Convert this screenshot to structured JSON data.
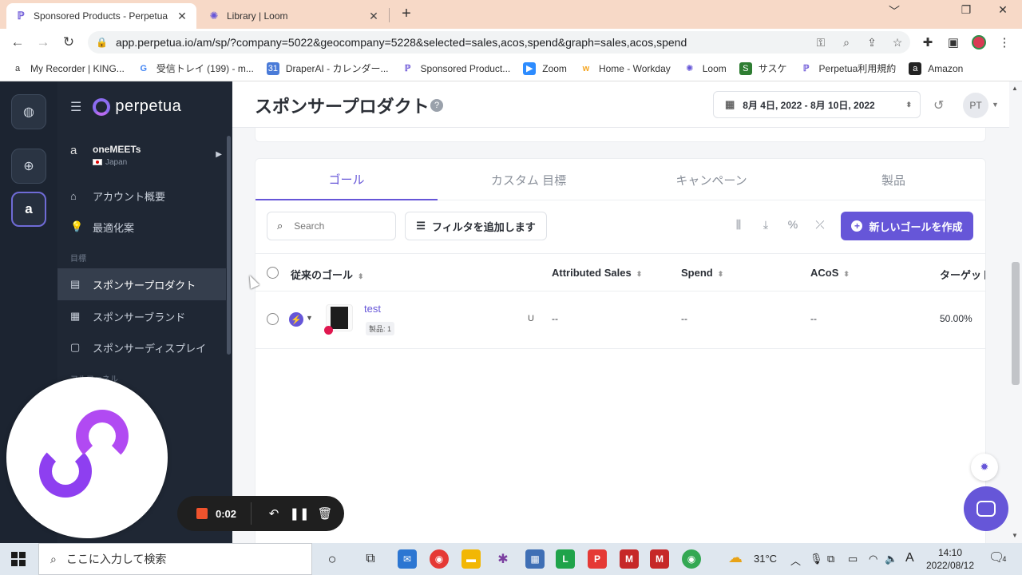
{
  "browser": {
    "tabs": [
      {
        "title": "Sponsored Products - Perpetua",
        "active": true,
        "icon": "perpetua-icon"
      },
      {
        "title": "Library | Loom",
        "active": false,
        "icon": "loom-icon"
      }
    ],
    "new_tab": "+",
    "window_controls": {
      "minimize": "﹀",
      "restore": "❐",
      "close": "✕"
    },
    "url": "app.perpetua.io/am/sp/?company=5022&geocompany=5228&selected=sales,acos,spend&graph=sales,acos,spend",
    "bookmarks": [
      {
        "label": "My Recorder | KING...",
        "icon": "amazon-icon"
      },
      {
        "label": "受信トレイ (199) - m...",
        "icon": "google-icon"
      },
      {
        "label": "DraperAI - カレンダー...",
        "icon": "calendar-icon"
      },
      {
        "label": "Sponsored Product...",
        "icon": "perpetua-icon"
      },
      {
        "label": "Zoom",
        "icon": "zoom-icon"
      },
      {
        "label": "Home - Workday",
        "icon": "workday-icon"
      },
      {
        "label": "Loom",
        "icon": "loom-icon"
      },
      {
        "label": "サスケ",
        "icon": "sasuke-icon"
      },
      {
        "label": "Perpetua利用規約",
        "icon": "perpetua-icon"
      },
      {
        "label": "Amazon",
        "icon": "amazon-icon"
      }
    ]
  },
  "sidebar": {
    "brand": "perpetua",
    "account": {
      "name": "oneMEETs",
      "country": "Japan"
    },
    "items": [
      {
        "label": "アカウント概要",
        "icon": "home-icon"
      },
      {
        "label": "最適化案",
        "icon": "lightbulb-icon"
      }
    ],
    "section_goals": "目標",
    "goal_items": [
      {
        "label": "スポンサープロダクト",
        "icon": "product-icon",
        "active": true
      },
      {
        "label": "スポンサーブランド",
        "icon": "brand-icon",
        "active": false
      },
      {
        "label": "スポンサーディスプレイ",
        "icon": "display-icon",
        "active": false
      }
    ],
    "section_funnel": "フルファネル"
  },
  "header": {
    "title": "スポンサープロダクト",
    "help": "?",
    "date_range": "8月 4日, 2022 - 8月 10日, 2022",
    "avatar": "PT"
  },
  "card": {
    "tabs": [
      {
        "label": "ゴール",
        "active": true
      },
      {
        "label": "カスタム 目標",
        "active": false
      },
      {
        "label": "キャンペーン",
        "active": false
      },
      {
        "label": "製品",
        "active": false
      }
    ],
    "search_placeholder": "Search",
    "add_filter": "フィルタを追加します",
    "create_goal": "新しいゴールを作成",
    "columns": [
      "従来のゴール",
      "Attributed Sales",
      "Spend",
      "ACoS",
      "ターゲット"
    ],
    "rows": [
      {
        "name": "test",
        "badge": "製品: 1",
        "flag": "U",
        "sales": "--",
        "spend": "--",
        "acos": "--",
        "target": "50.00%"
      }
    ]
  },
  "loom": {
    "time": "0:02"
  },
  "taskbar": {
    "search_placeholder": "ここに入力して検索",
    "weather": "31°C",
    "ime": "A",
    "time": "14:10",
    "date": "2022/08/12",
    "notifications": "4"
  },
  "colors": {
    "accent": "#6656d8",
    "sidebar": "#1f2734",
    "tabstrip": "#f7d9c7"
  }
}
